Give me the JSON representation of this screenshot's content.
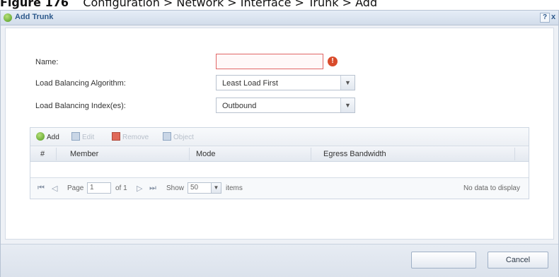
{
  "caption": {
    "figure_label": "Figure 176",
    "path": "Configuration > Network > Interface > Trunk > Add"
  },
  "dialog": {
    "title": "Add Trunk",
    "help_label": "?",
    "close_label": "x"
  },
  "form": {
    "name_label": "Name:",
    "name_value": "",
    "error_symbol": "!",
    "algorithm_label": "Load Balancing Algorithm:",
    "algorithm_value": "Least Load First",
    "index_label": "Load Balancing Index(es):",
    "index_value": "Outbound"
  },
  "toolbar": {
    "add_label": "Add",
    "edit_label": "Edit",
    "remove_label": "Remove",
    "object_label": "Object"
  },
  "grid": {
    "columns": [
      "#",
      "Member",
      "Mode",
      "Egress Bandwidth"
    ]
  },
  "pager": {
    "page_label": "Page",
    "page_value": "1",
    "of_label": "of 1",
    "show_label": "Show",
    "show_value": "50",
    "items_label": "items",
    "status": "No data to display"
  },
  "footer": {
    "ok_label": "",
    "cancel_label": "Cancel"
  },
  "icons": [
    "add-icon",
    "edit-icon",
    "remove-icon",
    "object-icon",
    "error-icon",
    "help-icon",
    "close-icon"
  ],
  "colors": {
    "accent": "#2e5a8c",
    "error": "#d94b2b",
    "add_green": "#4f9a1f"
  }
}
